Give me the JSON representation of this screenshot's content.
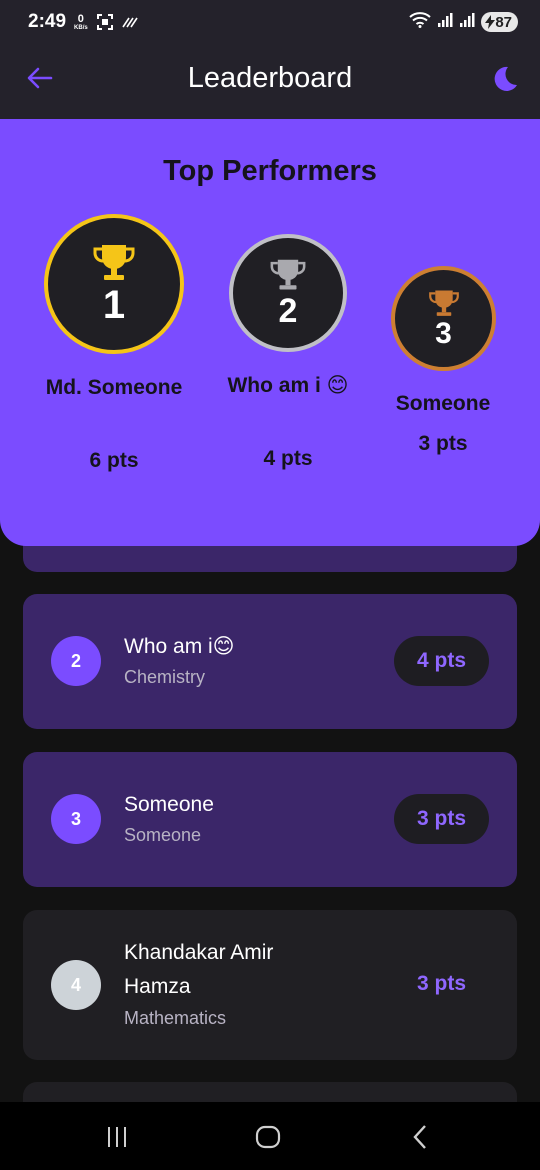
{
  "status_bar": {
    "time": "2:49",
    "net_speed_value": "0",
    "net_speed_unit": "KB/s",
    "battery": "87"
  },
  "app_bar": {
    "title": "Leaderboard",
    "back_icon": "arrow-left-icon",
    "theme_icon": "moon-icon",
    "accent_color": "#7b4cff"
  },
  "podium": {
    "title": "Top Performers",
    "entries": [
      {
        "rank": "1",
        "name": "Md. Someone",
        "points": "6 pts",
        "medal_color": "#f5c518",
        "icon": "trophy-icon"
      },
      {
        "rank": "2",
        "name": "Who am i 😊",
        "points": "4 pts",
        "medal_color": "#c0c0c6",
        "icon": "trophy-icon"
      },
      {
        "rank": "3",
        "name": "Someone",
        "points": "3 pts",
        "medal_color": "#cd7f32",
        "icon": "trophy-icon"
      }
    ]
  },
  "leaderboard": {
    "rows": [
      {
        "rank": "2",
        "name": "Who am i😊",
        "subject": "Chemistry",
        "points": "4 pts"
      },
      {
        "rank": "3",
        "name": "Someone",
        "subject": "Someone",
        "points": "3 pts"
      },
      {
        "rank": "4",
        "name": "Khandakar Amir Hamza",
        "subject": "Mathematics",
        "points": "3 pts"
      }
    ]
  },
  "nav_bar": {
    "recent_icon": "recent-apps-icon",
    "home_icon": "home-icon",
    "back_icon": "back-chevron-icon"
  }
}
